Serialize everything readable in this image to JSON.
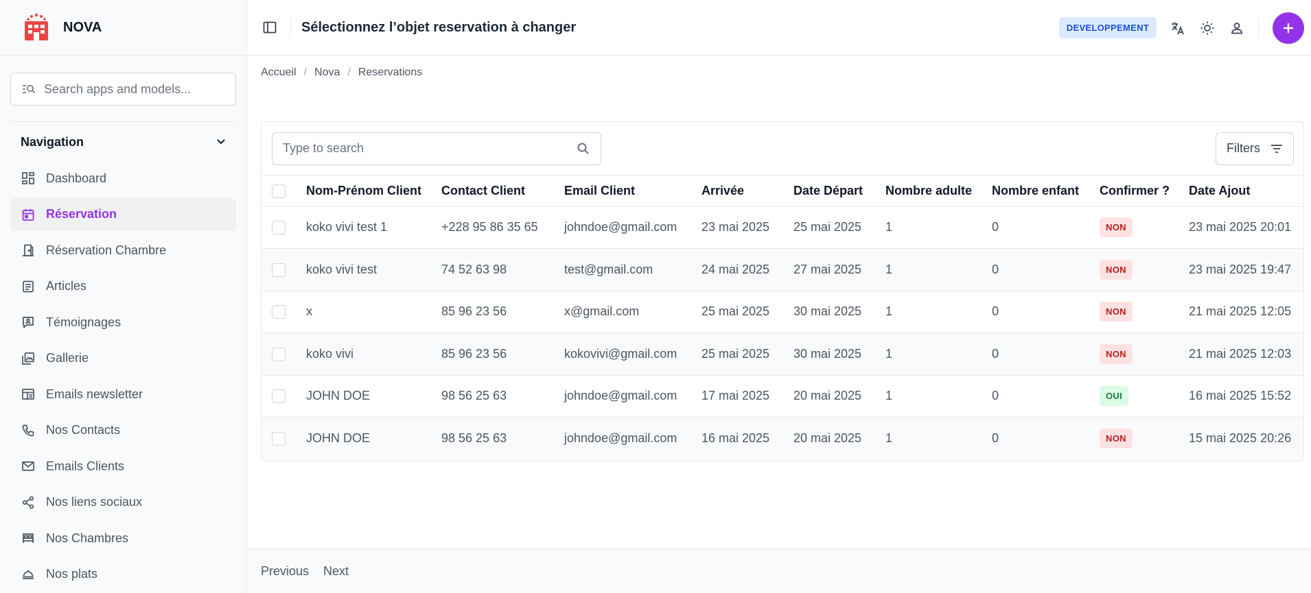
{
  "brand": {
    "name": "NOVA"
  },
  "sidebar": {
    "search_placeholder": "Search apps and models...",
    "nav_title": "Navigation",
    "items": [
      {
        "label": "Dashboard",
        "icon": "dashboard-icon",
        "active": false
      },
      {
        "label": "Réservation",
        "icon": "calendar-icon",
        "active": true
      },
      {
        "label": "Réservation Chambre",
        "icon": "door-icon",
        "active": false
      },
      {
        "label": "Articles",
        "icon": "article-icon",
        "active": false
      },
      {
        "label": "Témoignages",
        "icon": "testimonial-icon",
        "active": false
      },
      {
        "label": "Gallerie",
        "icon": "gallery-icon",
        "active": false
      },
      {
        "label": "Emails newsletter",
        "icon": "newsletter-icon",
        "active": false
      },
      {
        "label": "Nos Contacts",
        "icon": "phone-icon",
        "active": false
      },
      {
        "label": "Emails Clients",
        "icon": "mail-icon",
        "active": false
      },
      {
        "label": "Nos liens sociaux",
        "icon": "share-icon",
        "active": false
      },
      {
        "label": "Nos Chambres",
        "icon": "bed-icon",
        "active": false
      },
      {
        "label": "Nos plats",
        "icon": "dish-icon",
        "active": false
      }
    ]
  },
  "header": {
    "title": "Sélectionnez l’objet reservation à changer",
    "env_badge": "DEVELOPPEMENT"
  },
  "breadcrumb": [
    "Accueil",
    "Nova",
    "Reservations"
  ],
  "table": {
    "search_placeholder": "Type to search",
    "filters_label": "Filters",
    "columns": [
      "Nom-Prénom Client",
      "Contact Client",
      "Email Client",
      "Arrivée",
      "Date Départ",
      "Nombre adulte",
      "Nombre enfant",
      "Confirmer ?",
      "Date Ajout"
    ],
    "rows": [
      {
        "name": "koko vivi test 1",
        "contact": "+228 95 86 35 65",
        "email": "johndoe@gmail.com",
        "arrival": "23 mai 2025",
        "departure": "25 mai 2025",
        "adults": "1",
        "children": "0",
        "confirmed": "NON",
        "added": "23 mai 2025 20:01"
      },
      {
        "name": "koko vivi test",
        "contact": "74 52 63 98",
        "email": "test@gmail.com",
        "arrival": "24 mai 2025",
        "departure": "27 mai 2025",
        "adults": "1",
        "children": "0",
        "confirmed": "NON",
        "added": "23 mai 2025 19:47"
      },
      {
        "name": "x",
        "contact": "85 96 23 56",
        "email": "x@gmail.com",
        "arrival": "25 mai 2025",
        "departure": "30 mai 2025",
        "adults": "1",
        "children": "0",
        "confirmed": "NON",
        "added": "21 mai 2025 12:05"
      },
      {
        "name": "koko vivi",
        "contact": "85 96 23 56",
        "email": "kokovivi@gmail.com",
        "arrival": "25 mai 2025",
        "departure": "30 mai 2025",
        "adults": "1",
        "children": "0",
        "confirmed": "NON",
        "added": "21 mai 2025 12:03"
      },
      {
        "name": "JOHN DOE",
        "contact": "98 56 25 63",
        "email": "johndoe@gmail.com",
        "arrival": "17 mai 2025",
        "departure": "20 mai 2025",
        "adults": "1",
        "children": "0",
        "confirmed": "OUI",
        "added": "16 mai 2025 15:52"
      },
      {
        "name": "JOHN DOE",
        "contact": "98 56 25 63",
        "email": "johndoe@gmail.com",
        "arrival": "16 mai 2025",
        "departure": "20 mai 2025",
        "adults": "1",
        "children": "0",
        "confirmed": "NON",
        "added": "15 mai 2025 20:26"
      }
    ]
  },
  "pagination": {
    "previous": "Previous",
    "next": "Next"
  },
  "colors": {
    "accent": "#9333ea",
    "badge_no_bg": "#fee2e2",
    "badge_yes_bg": "#dcfce7"
  }
}
